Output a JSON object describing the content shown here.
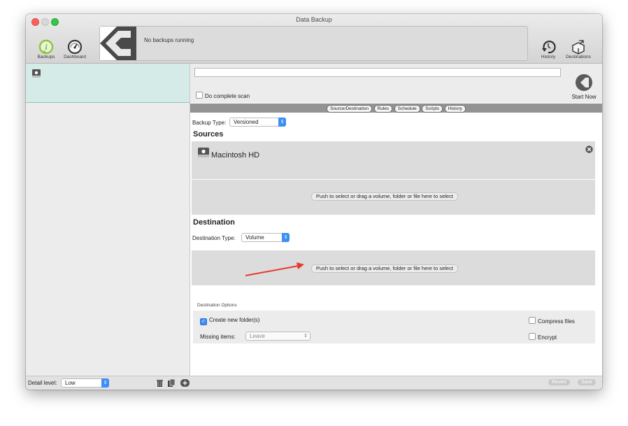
{
  "window": {
    "title": "Data Backup"
  },
  "toolbar": {
    "backups_label": "Backups",
    "dashboard_label": "Dashboard",
    "history_label": "History",
    "destinations_label": "Destinations"
  },
  "status": {
    "message": "No backups running"
  },
  "top": {
    "do_complete_scan_label": "Do complete scan",
    "start_now_label": "Start Now"
  },
  "tabs": [
    "Source/Destination",
    "Rules",
    "Schedule",
    "Scripts",
    "History"
  ],
  "backup_type": {
    "label": "Backup Type:",
    "value": "Versioned"
  },
  "sources": {
    "header": "Sources",
    "items": [
      {
        "name": "Macintosh HD"
      }
    ],
    "push_label": "Push to select or drag a volume, folder or file here to select"
  },
  "destination": {
    "header": "Destination",
    "type_label": "Destination Type:",
    "type_value": "Volume",
    "push_label": "Push to select or drag a volume, folder or file here to select"
  },
  "destination_options": {
    "header": "Destination Options",
    "create_new_folders_label": "Create new folder(s)",
    "create_new_folders_checked": true,
    "missing_items_label": "Missing items:",
    "missing_items_value": "Leave",
    "compress_files_label": "Compress files",
    "compress_files_checked": false,
    "encrypt_label": "Encrypt",
    "encrypt_checked": false
  },
  "bottom": {
    "detail_level_label": "Detail level:",
    "detail_level_value": "Low",
    "revert_label": "Revert",
    "save_label": "Save"
  },
  "colors": {
    "accent": "#3d8ef5",
    "selection": "#d5ebe8",
    "arrow": "#e8392c",
    "backups_icon": "#8cc63f"
  }
}
